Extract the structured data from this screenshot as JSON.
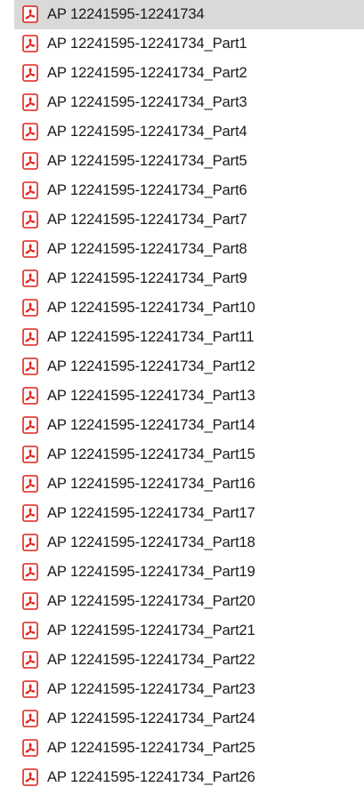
{
  "files": {
    "icon": "pdf-icon",
    "accent_color": "#e0231b",
    "selected_index": 0,
    "items": [
      "AP 12241595-12241734",
      "AP 12241595-12241734_Part1",
      "AP 12241595-12241734_Part2",
      "AP 12241595-12241734_Part3",
      "AP 12241595-12241734_Part4",
      "AP 12241595-12241734_Part5",
      "AP 12241595-12241734_Part6",
      "AP 12241595-12241734_Part7",
      "AP 12241595-12241734_Part8",
      "AP 12241595-12241734_Part9",
      "AP 12241595-12241734_Part10",
      "AP 12241595-12241734_Part11",
      "AP 12241595-12241734_Part12",
      "AP 12241595-12241734_Part13",
      "AP 12241595-12241734_Part14",
      "AP 12241595-12241734_Part15",
      "AP 12241595-12241734_Part16",
      "AP 12241595-12241734_Part17",
      "AP 12241595-12241734_Part18",
      "AP 12241595-12241734_Part19",
      "AP 12241595-12241734_Part20",
      "AP 12241595-12241734_Part21",
      "AP 12241595-12241734_Part22",
      "AP 12241595-12241734_Part23",
      "AP 12241595-12241734_Part24",
      "AP 12241595-12241734_Part25",
      "AP 12241595-12241734_Part26"
    ]
  }
}
